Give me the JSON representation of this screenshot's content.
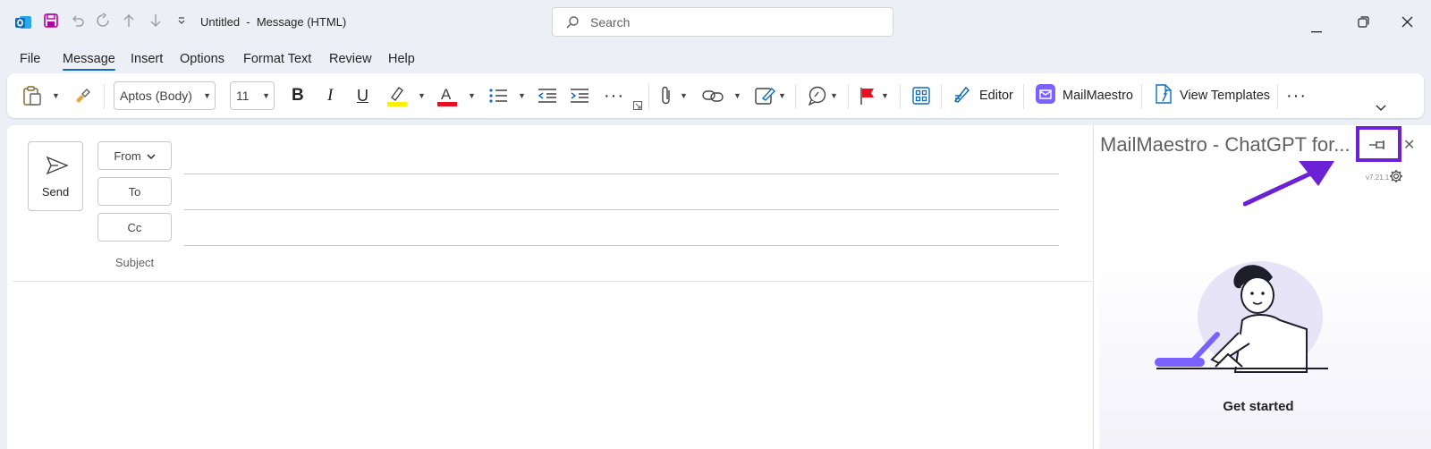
{
  "window": {
    "title": "Untitled  -  Message (HTML)"
  },
  "search": {
    "placeholder": "Search"
  },
  "menu": {
    "tabs": [
      "File",
      "Message",
      "Insert",
      "Options",
      "Format Text",
      "Review",
      "Help"
    ],
    "active": "Message"
  },
  "ribbon": {
    "font_name": "Aptos (Body)",
    "font_size": "11",
    "editor_label": "Editor",
    "mailmaestro_label": "MailMaestro",
    "view_templates_label": "View Templates"
  },
  "compose": {
    "send_label": "Send",
    "from_label": "From",
    "to_label": "To",
    "cc_label": "Cc",
    "subject_label": "Subject"
  },
  "addin": {
    "title": "MailMaestro - ChatGPT for...",
    "version": "v7.21.1",
    "get_started": "Get started"
  },
  "colors": {
    "accent": "#0f6cbd",
    "annotation": "#6b21d6",
    "brand_purple": "#7b61ff"
  }
}
